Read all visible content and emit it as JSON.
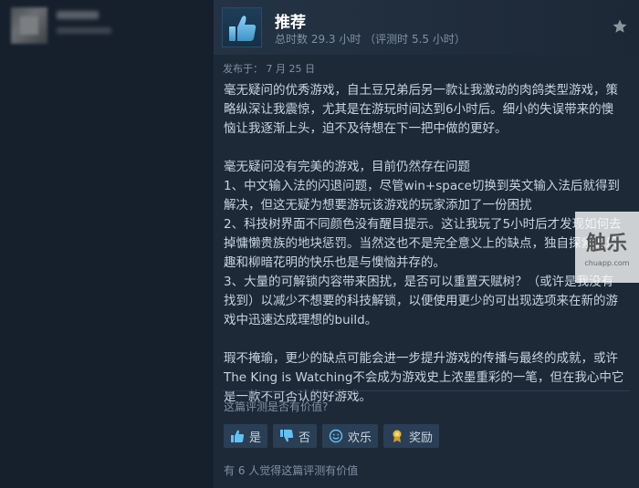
{
  "review": {
    "recommendation": "推荐",
    "hours": "总时数 29.3 小时 （评测时 5.5 小时）",
    "posted": "发布于： 7 月 25 日",
    "paragraphs": [
      "毫无疑问的优秀游戏，自土豆兄弟后另一款让我激动的肉鸽类型游戏，策略纵深让我震惊，尤其是在游玩时间达到6小时后。细小的失误带来的懊恼让我逐渐上头，迫不及待想在下一把中做的更好。",
      "",
      "毫无疑问没有完美的游戏，目前仍然存在问题",
      "1、中文输入法的闪退问题，尽管win+space切换到英文输入法后就得到解决，但这无疑为想要游玩该游戏的玩家添加了一份困扰",
      "2、科技树界面不同颜色没有醒目提示。这让我玩了5小时后才发现如何去掉慵懒贵族的地块惩罚。当然这也不是完全意义上的缺点，独自探索的乐趣和柳暗花明的快乐也是与懊恼并存的。",
      "3、大量的可解锁内容带来困扰，是否可以重置天赋树？（或许是我没有找到）以减少不想要的科技解锁，以便使用更少的可出现选项来在新的游戏中迅速达成理想的build。",
      "",
      "瑕不掩瑜，更少的缺点可能会进一步提升游戏的传播与最终的成就，或许The King is Watching不会成为游戏史上浓墨重彩的一笔，但在我心中它是一款不可否认的好游戏。"
    ],
    "helpful_question": "这篇评测是否有价值?",
    "buttons": {
      "yes": "是",
      "no": "否",
      "funny": "欢乐",
      "award": "奖励"
    },
    "helpful_count": "有 6 人觉得这篇评测有价值"
  },
  "watermark": {
    "logo": "触乐",
    "url": "chuapp.com"
  },
  "colors": {
    "background": "#16202d",
    "review_bg": "#1e2938",
    "text": "#c6d4df",
    "muted": "#8091a2",
    "button_bg": "#2a3f55",
    "thumb_accent": "#66c0f4"
  },
  "icons": {
    "recommend": "thumbs-up-icon",
    "star": "star-icon"
  }
}
